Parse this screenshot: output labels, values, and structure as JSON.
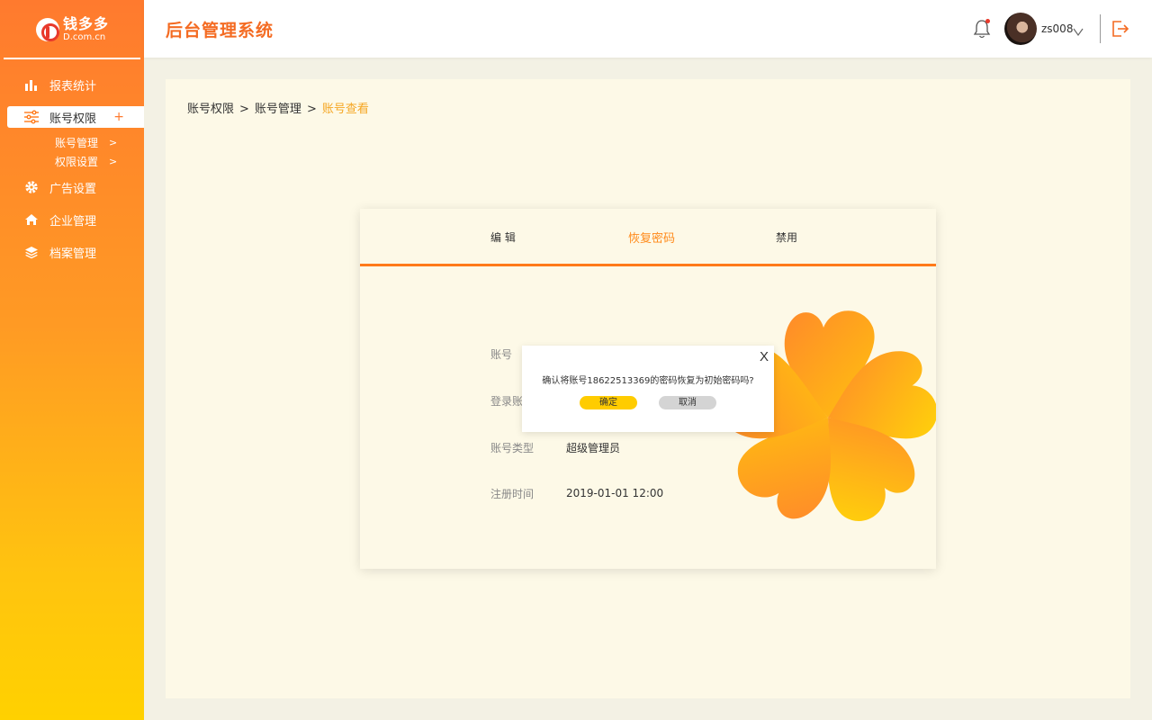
{
  "brand": {
    "name": "钱多多",
    "domain": "D.com.cn"
  },
  "sidebar": {
    "items": [
      {
        "label": "报表统计",
        "icon": "bar-chart-icon"
      },
      {
        "label": "账号权限",
        "icon": "sliders-icon",
        "expand": "+"
      },
      {
        "label": "广告设置",
        "icon": "gear-icon"
      },
      {
        "label": "企业管理",
        "icon": "home-icon"
      },
      {
        "label": "档案管理",
        "icon": "layers-icon"
      }
    ],
    "subitems": [
      {
        "label": "账号管理",
        "arrow": ">"
      },
      {
        "label": "权限设置",
        "arrow": ">"
      }
    ]
  },
  "header": {
    "title": "后台管理系统",
    "username": "zs008"
  },
  "breadcrumb": {
    "items": [
      "账号权限",
      "账号管理",
      "账号查看"
    ],
    "separator": ">"
  },
  "card": {
    "tabs": [
      "编  辑",
      "恢复密码",
      "禁用"
    ],
    "fields": [
      {
        "label": "账号",
        "value": ""
      },
      {
        "label": "登录账",
        "value": ""
      },
      {
        "label": "账号类型",
        "value": "超级管理员"
      },
      {
        "label": "注册时间",
        "value": "2019-01-01 12:00"
      }
    ]
  },
  "dialog": {
    "message": "确认将账号18622513369的密码恢复为初始密码吗?",
    "confirm": "确定",
    "cancel": "取消",
    "close": "X"
  },
  "colors": {
    "accent": "#ff7a1a",
    "title": "#f46b22",
    "breadcrumb_current": "#f5a623",
    "confirm": "#ffcc00",
    "cancel": "#d4d4d4"
  }
}
